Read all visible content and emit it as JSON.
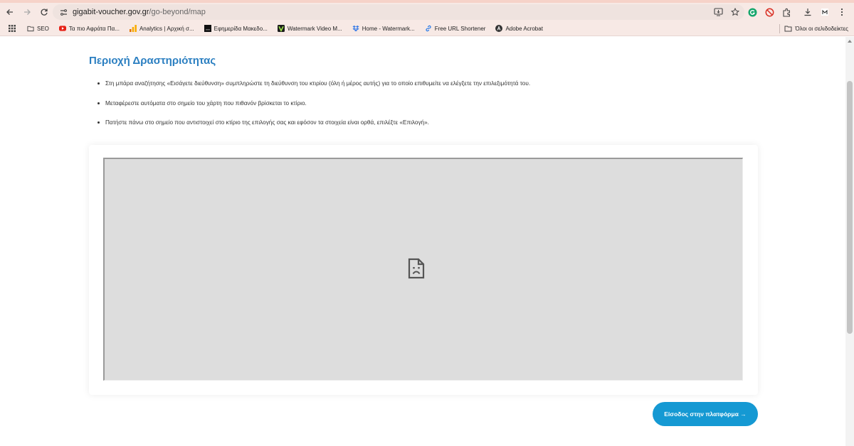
{
  "browser": {
    "url_domain": "gigabit-voucher.gov.gr",
    "url_path": "/go-beyond/map",
    "bookmarks": [
      {
        "label": "SEO",
        "icon": "folder-icon"
      },
      {
        "label": "Τα πιο Αφράτα Πα...",
        "icon": "youtube-icon"
      },
      {
        "label": "Analytics | Αρχική σ...",
        "icon": "analytics-icon"
      },
      {
        "label": "Εφημερίδα Μακεδο...",
        "icon": "newspaper-icon"
      },
      {
        "label": "Watermark Video M...",
        "icon": "watermark-v-icon"
      },
      {
        "label": "Home - Watermark...",
        "icon": "dropbox-icon"
      },
      {
        "label": "Free URL Shortener",
        "icon": "link-icon"
      },
      {
        "label": "Adobe Acrobat",
        "icon": "acrobat-icon"
      }
    ],
    "all_bookmarks_label": "Όλοι οι σελιδοδείκτες"
  },
  "page": {
    "title": "Περιοχή Δραστηριότητας",
    "instructions": [
      "Στη μπάρα αναζήτησης «Εισάγετε διεύθυνση» συμπληρώστε τη διεύθυνση του κτιρίου (όλη ή μέρος αυτής) για το οποίο επιθυμείτε να ελέγξετε την επιλεξιμότητά του.",
      "Μεταφέρεστε αυτόματα στο σημείο του χάρτη που πιθανόν βρίσκεται το κτίριο.",
      "Πατήστε πάνω στο σημείο που αντιστοιχεί στο κτίριο της επιλογής σας και εφόσον τα στοιχεία είναι ορθά, επιλέξτε «Επιλογή»."
    ],
    "cta_label": "Είσοδος στην πλατφόρμα →"
  },
  "colors": {
    "title": "#2b7fc1",
    "cta_background": "#1599d3",
    "map_placeholder": "#dddddd"
  }
}
